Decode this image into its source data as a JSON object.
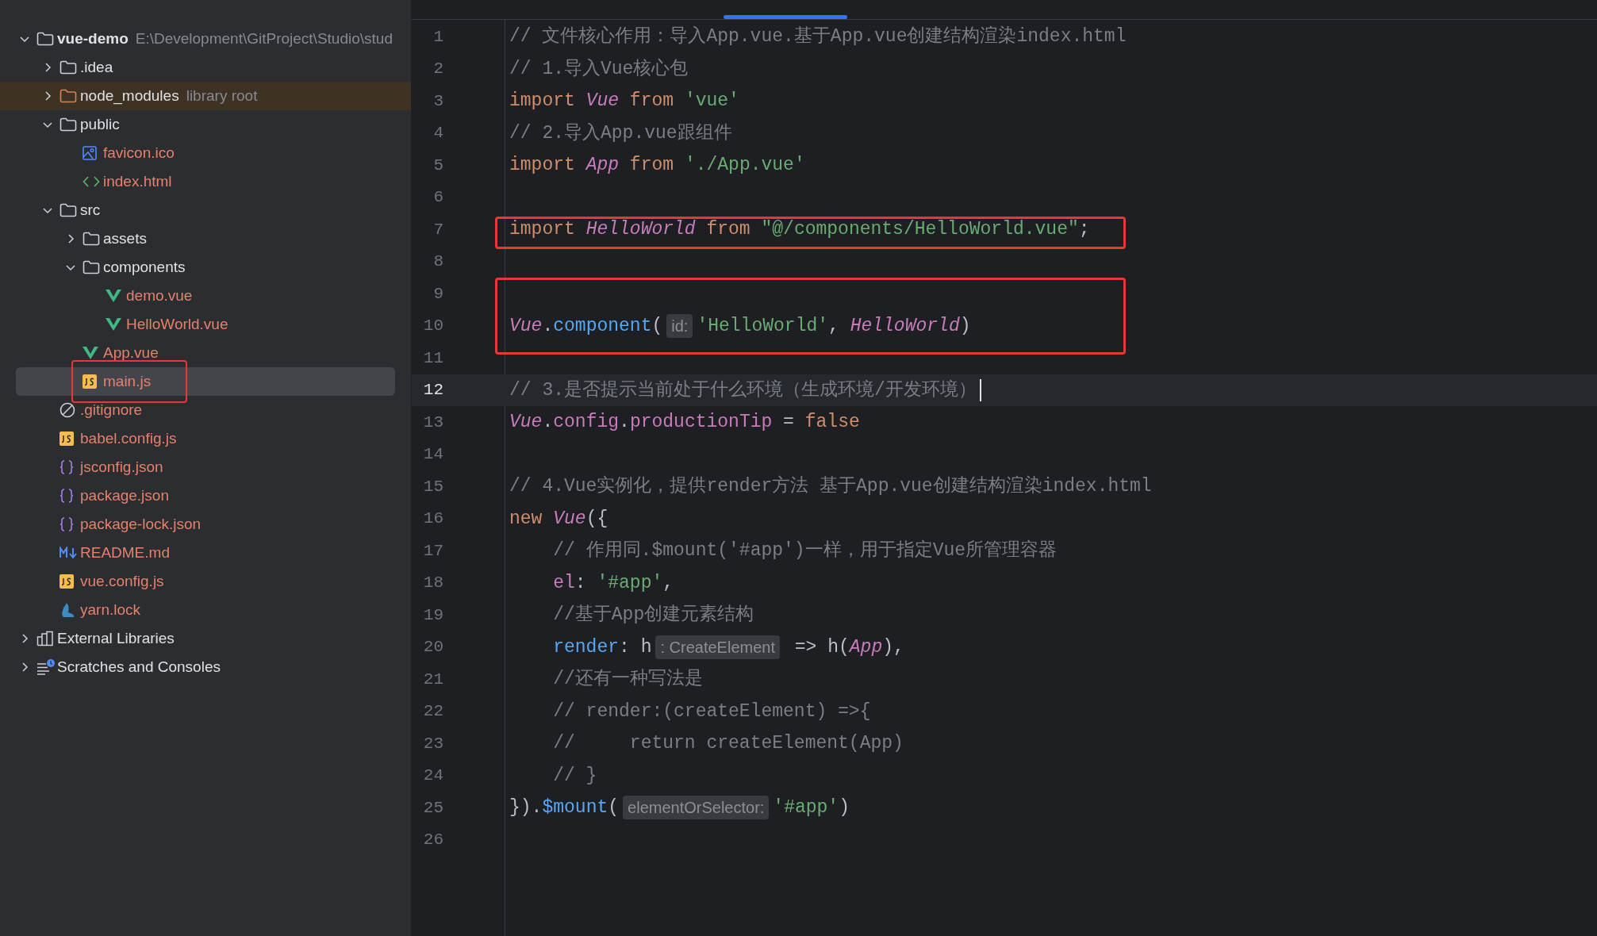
{
  "project_tree": [
    {
      "name": "vue-demo",
      "kind": "folder",
      "bold": true,
      "hint": "E:\\Development\\GitProject\\Studio\\stud",
      "expanded": true,
      "children": [
        {
          "name": ".idea",
          "kind": "folder",
          "expanded": false
        },
        {
          "name": "node_modules",
          "kind": "library_folder",
          "hint": "library root",
          "expanded": false
        },
        {
          "name": "public",
          "kind": "folder",
          "expanded": true,
          "children": [
            {
              "name": "favicon.ico",
              "kind": "image"
            },
            {
              "name": "index.html",
              "kind": "html"
            }
          ]
        },
        {
          "name": "src",
          "kind": "folder",
          "expanded": true,
          "children": [
            {
              "name": "assets",
              "kind": "folder",
              "expanded": false
            },
            {
              "name": "components",
              "kind": "folder",
              "expanded": true,
              "children": [
                {
                  "name": "demo.vue",
                  "kind": "vue"
                },
                {
                  "name": "HelloWorld.vue",
                  "kind": "vue"
                }
              ]
            },
            {
              "name": "App.vue",
              "kind": "vue"
            },
            {
              "name": "main.js",
              "kind": "js",
              "selected": true,
              "boxed": true
            }
          ]
        },
        {
          "name": ".gitignore",
          "kind": "ignore"
        },
        {
          "name": "babel.config.js",
          "kind": "js"
        },
        {
          "name": "jsconfig.json",
          "kind": "json"
        },
        {
          "name": "package.json",
          "kind": "json"
        },
        {
          "name": "package-lock.json",
          "kind": "json"
        },
        {
          "name": "README.md",
          "kind": "markdown"
        },
        {
          "name": "vue.config.js",
          "kind": "js"
        },
        {
          "name": "yarn.lock",
          "kind": "yarn"
        }
      ]
    },
    {
      "name": "External Libraries",
      "kind": "libraries",
      "expanded": false
    },
    {
      "name": "Scratches and Consoles",
      "kind": "scratches",
      "expanded": false
    }
  ],
  "editor": {
    "lines": [
      {
        "number": "1",
        "tokens": [
          {
            "kind": "comment",
            "text": "// 文件核心作用：导入App.vue.基于App.vue创建结构渲染index.html"
          }
        ]
      },
      {
        "number": "2",
        "tokens": [
          {
            "kind": "comment",
            "text": "// 1.导入Vue核心包"
          }
        ]
      },
      {
        "number": "3",
        "tokens": [
          {
            "kind": "keyword",
            "text": "import "
          },
          {
            "kind": "class",
            "text": "Vue"
          },
          {
            "kind": "keyword",
            "text": " from "
          },
          {
            "kind": "string",
            "text": "'vue'"
          }
        ]
      },
      {
        "number": "4",
        "tokens": [
          {
            "kind": "comment",
            "text": "// 2.导入App.vue跟组件"
          }
        ]
      },
      {
        "number": "5",
        "tokens": [
          {
            "kind": "keyword",
            "text": "import "
          },
          {
            "kind": "class",
            "text": "App"
          },
          {
            "kind": "keyword",
            "text": " from "
          },
          {
            "kind": "string",
            "text": "'./App.vue'"
          }
        ]
      },
      {
        "number": "6"
      },
      {
        "number": "7",
        "boxed": true,
        "tokens": [
          {
            "kind": "keyword",
            "text": "import "
          },
          {
            "kind": "class",
            "text": "HelloWorld"
          },
          {
            "kind": "keyword",
            "text": " from "
          },
          {
            "kind": "string",
            "text": "\"@/components/HelloWorld.vue\""
          },
          {
            "kind": "plain",
            "text": ";"
          }
        ]
      },
      {
        "number": "8"
      },
      {
        "number": "9",
        "boxed": true
      },
      {
        "number": "10",
        "boxed": true,
        "tokens": [
          {
            "kind": "class",
            "text": "Vue"
          },
          {
            "kind": "plain",
            "text": "."
          },
          {
            "kind": "function",
            "text": "component"
          },
          {
            "kind": "plain",
            "text": "("
          },
          {
            "kind": "hint",
            "text": "id:"
          },
          {
            "kind": "string",
            "text": "'HelloWorld'"
          },
          {
            "kind": "plain",
            "text": ", "
          },
          {
            "kind": "class",
            "text": "HelloWorld"
          },
          {
            "kind": "plain",
            "text": ")"
          }
        ]
      },
      {
        "number": "11"
      },
      {
        "number": "12",
        "current": true,
        "tokens": [
          {
            "kind": "comment",
            "text": "// 3.是否提示当前处于什么环境（生成环境/开发环境）"
          }
        ]
      },
      {
        "number": "13",
        "tokens": [
          {
            "kind": "class",
            "text": "Vue"
          },
          {
            "kind": "plain",
            "text": "."
          },
          {
            "kind": "property",
            "text": "config"
          },
          {
            "kind": "plain",
            "text": "."
          },
          {
            "kind": "property",
            "text": "productionTip"
          },
          {
            "kind": "plain",
            "text": " = "
          },
          {
            "kind": "keyword",
            "text": "false"
          }
        ]
      },
      {
        "number": "14"
      },
      {
        "number": "15",
        "tokens": [
          {
            "kind": "comment",
            "text": "// 4.Vue实例化，提供render方法 基于App.vue创建结构渲染index.html"
          }
        ]
      },
      {
        "number": "16",
        "tokens": [
          {
            "kind": "keyword",
            "text": "new "
          },
          {
            "kind": "class",
            "text": "Vue"
          },
          {
            "kind": "plain",
            "text": "({"
          }
        ]
      },
      {
        "number": "17",
        "tokens": [
          {
            "kind": "comment",
            "text": "    // 作用同.$mount('#app')一样，用于指定Vue所管理容器"
          }
        ]
      },
      {
        "number": "18",
        "tokens": [
          {
            "kind": "property",
            "text": "    el"
          },
          {
            "kind": "plain",
            "text": ": "
          },
          {
            "kind": "string",
            "text": "'#app'"
          },
          {
            "kind": "plain",
            "text": ","
          }
        ]
      },
      {
        "number": "19",
        "tokens": [
          {
            "kind": "comment",
            "text": "    //基于App创建元素结构"
          }
        ]
      },
      {
        "number": "20",
        "tokens": [
          {
            "kind": "function",
            "text": "    render"
          },
          {
            "kind": "plain",
            "text": ": h"
          },
          {
            "kind": "hint",
            "text": ": CreateElement"
          },
          {
            "kind": "plain",
            "text": " => h("
          },
          {
            "kind": "class",
            "text": "App"
          },
          {
            "kind": "plain",
            "text": "),"
          }
        ]
      },
      {
        "number": "21",
        "tokens": [
          {
            "kind": "comment",
            "text": "    //还有一种写法是"
          }
        ]
      },
      {
        "number": "22",
        "tokens": [
          {
            "kind": "comment",
            "text": "    // render:(createElement) =>{"
          }
        ]
      },
      {
        "number": "23",
        "tokens": [
          {
            "kind": "comment",
            "text": "    //     return createElement(App)"
          }
        ]
      },
      {
        "number": "24",
        "tokens": [
          {
            "kind": "comment",
            "text": "    // }"
          }
        ]
      },
      {
        "number": "25",
        "tokens": [
          {
            "kind": "plain",
            "text": "})."
          },
          {
            "kind": "function",
            "text": "$mount"
          },
          {
            "kind": "plain",
            "text": "("
          },
          {
            "kind": "hint",
            "text": "elementOrSelector:"
          },
          {
            "kind": "string",
            "text": "'#app'"
          },
          {
            "kind": "plain",
            "text": ")"
          }
        ]
      },
      {
        "number": "26"
      }
    ]
  }
}
